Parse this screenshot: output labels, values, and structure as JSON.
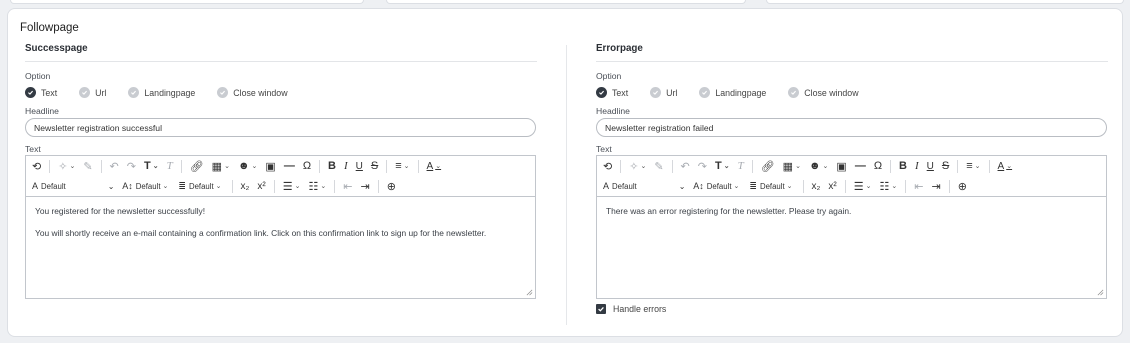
{
  "panel": {
    "title": "Followpage"
  },
  "options_label": "Option",
  "headline_label": "Headline",
  "text_label": "Text",
  "option_items": [
    "Text",
    "Url",
    "Landingpage",
    "Close window"
  ],
  "toolbar": {
    "font_family": "Default",
    "font_size": "Default",
    "line_height": "Default"
  },
  "success": {
    "title": "Successpage",
    "selected_option": "Text",
    "headline": "Newsletter registration successful",
    "paragraphs": [
      "You registered for the newsletter successfully!",
      "You will shortly receive an e-mail containing a confirmation link. Click on this confirmation link to sign up for the newsletter."
    ]
  },
  "error": {
    "title": "Errorpage",
    "selected_option": "Text",
    "headline": "Newsletter registration failed",
    "paragraphs": [
      "There was an error registering for the newsletter. Please try again."
    ],
    "handle_errors_label": "Handle errors",
    "handle_errors_checked": true
  },
  "colors": {
    "selected": "#333a43",
    "unselected": "#c9ccd1",
    "border": "#c2c6cc"
  }
}
